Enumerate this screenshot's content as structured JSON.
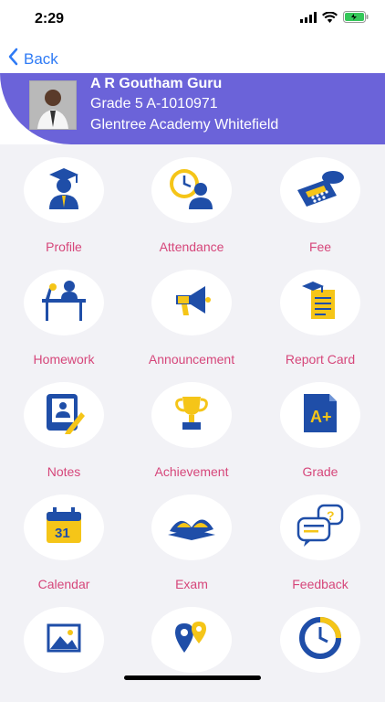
{
  "status_bar": {
    "time": "2:29"
  },
  "nav": {
    "back_label": "Back"
  },
  "student": {
    "name": "A R Goutham Guru",
    "grade": "Grade 5 A-1010971",
    "school": "Glentree Academy Whitefield"
  },
  "tiles": [
    {
      "label": "Profile",
      "icon": "profile-icon"
    },
    {
      "label": "Attendance",
      "icon": "attendance-icon"
    },
    {
      "label": "Fee",
      "icon": "fee-icon"
    },
    {
      "label": "Homework",
      "icon": "homework-icon"
    },
    {
      "label": "Announcement",
      "icon": "announcement-icon"
    },
    {
      "label": "Report Card",
      "icon": "report-card-icon"
    },
    {
      "label": "Notes",
      "icon": "notes-icon"
    },
    {
      "label": "Achievement",
      "icon": "achievement-icon"
    },
    {
      "label": "Grade",
      "icon": "grade-icon"
    },
    {
      "label": "Calendar",
      "icon": "calendar-icon"
    },
    {
      "label": "Exam",
      "icon": "exam-icon"
    },
    {
      "label": "Feedback",
      "icon": "feedback-icon"
    },
    {
      "label": "",
      "icon": "gallery-icon"
    },
    {
      "label": "",
      "icon": "location-icon"
    },
    {
      "label": "",
      "icon": "timer-icon"
    }
  ],
  "calendar_day": "31",
  "grade_icon_text": "A+",
  "colors": {
    "accent_purple": "#6b63d9",
    "label_pink": "#d6467a",
    "icon_blue": "#1f4ea8",
    "icon_yellow": "#f5c518",
    "back_blue": "#2f7bf5"
  }
}
